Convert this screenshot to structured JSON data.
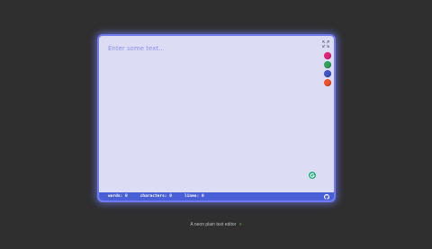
{
  "editor": {
    "placeholder": "Enter some text...",
    "value": ""
  },
  "toolbar": {
    "fullscreen_icon": "fullscreen-icon",
    "swatches": [
      {
        "name": "pink",
        "color": "#e0247a"
      },
      {
        "name": "green",
        "color": "#2ea35a"
      },
      {
        "name": "blue",
        "color": "#3b56c9"
      },
      {
        "name": "orange",
        "color": "#f0502a"
      }
    ]
  },
  "grammar_icon": {
    "name": "grammar-check-icon",
    "color": "#22b07a"
  },
  "status_bar": {
    "words_label": "words:",
    "words_value": "0",
    "characters_label": "characters:",
    "characters_value": "0",
    "lines_label": "lines:",
    "lines_value": "0",
    "github_icon": "github-icon"
  },
  "footer": {
    "text": "A neon plain text editor",
    "arrow": ">"
  },
  "colors": {
    "page_bg": "#2f2f2f",
    "editor_bg": "#dcdcf4",
    "accent": "#4a5fd6",
    "glow": "#6f7cf0"
  }
}
